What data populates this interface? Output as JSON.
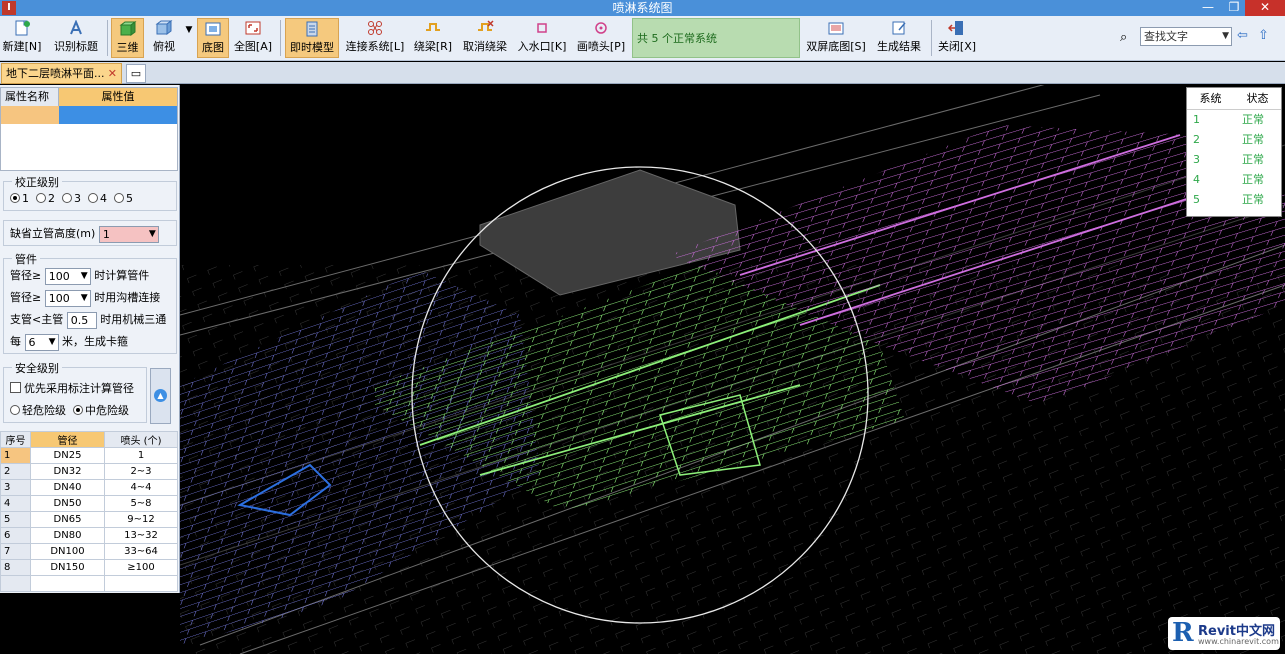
{
  "window": {
    "title": "喷淋系统图",
    "app_icon": "I"
  },
  "toolbar": {
    "buttons": [
      {
        "label": "新建[N]",
        "icon": "new-doc-icon"
      },
      {
        "label": "识别标题",
        "icon": "recognize-icon"
      },
      {
        "label": "三维",
        "icon": "3d-icon",
        "active": true
      },
      {
        "label": "俯视",
        "icon": "top-view-icon"
      },
      {
        "label": "底图",
        "icon": "base-map-icon",
        "active": true
      },
      {
        "label": "全图[A]",
        "icon": "full-view-icon"
      },
      {
        "label": "即时模型",
        "icon": "instant-model-icon",
        "active": true
      },
      {
        "label": "连接系统[L]",
        "icon": "connect-system-icon"
      },
      {
        "label": "绕梁[R]",
        "icon": "beam-bypass-icon"
      },
      {
        "label": "取消绕梁",
        "icon": "cancel-bypass-icon"
      },
      {
        "label": "入水口[K]",
        "icon": "water-inlet-icon"
      },
      {
        "label": "画喷头[P]",
        "icon": "sprinkler-icon"
      },
      {
        "label": "双屏底图[S]",
        "icon": "dual-screen-icon"
      },
      {
        "label": "生成结果",
        "icon": "generate-result-icon"
      },
      {
        "label": "关闭[X]",
        "icon": "close-door-icon"
      }
    ],
    "status": "共 5 个正常系统",
    "search_placeholder": "查找文字"
  },
  "tabs": {
    "active": "地下二层喷淋平面...",
    "close": "✕"
  },
  "properties": {
    "col_name": "属性名称",
    "col_value": "属性值"
  },
  "calibration": {
    "title": "校正级别",
    "options": [
      "1",
      "2",
      "3",
      "4",
      "5"
    ],
    "selected": "1"
  },
  "riser": {
    "label": "缺省立管高度(m)",
    "value": "1"
  },
  "pipes": {
    "title": "管件",
    "row1": {
      "prefix": "管径≥",
      "value": "100",
      "suffix": "时计算管件"
    },
    "row2": {
      "prefix": "管径≥",
      "value": "100",
      "suffix": "时用沟槽连接"
    },
    "row3": {
      "prefix": "支管<主管",
      "value": "0.5",
      "suffix": "时用机械三通"
    },
    "row4": {
      "prefix": "每",
      "value": "6",
      "suffix": "米，生成卡箍"
    }
  },
  "safety": {
    "title": "安全级别",
    "checkbox": "优先采用标注计算管径",
    "light": "轻危险级",
    "medium": "中危险级",
    "selected": "medium"
  },
  "pipe_table": {
    "headers": [
      "序号",
      "管径",
      "喷头 (个)"
    ],
    "rows": [
      [
        "1",
        "DN25",
        "1"
      ],
      [
        "2",
        "DN32",
        "2~3"
      ],
      [
        "3",
        "DN40",
        "4~4"
      ],
      [
        "4",
        "DN50",
        "5~8"
      ],
      [
        "5",
        "DN65",
        "9~12"
      ],
      [
        "6",
        "DN80",
        "13~32"
      ],
      [
        "7",
        "DN100",
        "33~64"
      ],
      [
        "8",
        "DN150",
        "≥100"
      ]
    ]
  },
  "systems": {
    "col_system": "系统",
    "col_status": "状态",
    "rows": [
      {
        "id": "1",
        "status": "正常"
      },
      {
        "id": "2",
        "status": "正常"
      },
      {
        "id": "3",
        "status": "正常"
      },
      {
        "id": "4",
        "status": "正常"
      },
      {
        "id": "5",
        "status": "正常"
      }
    ]
  },
  "watermark": {
    "title": "Revit中文网",
    "url": "www.chinarevit.com"
  },
  "colors": {
    "green": "#8df07a",
    "purple": "#cf6ee0",
    "blue": "#7a7ee8",
    "accent": "#3d8fe4",
    "status_ok": "#2ea84a"
  }
}
